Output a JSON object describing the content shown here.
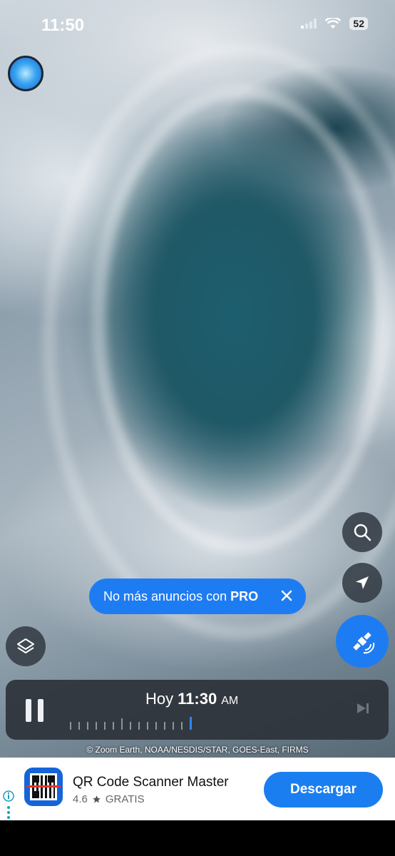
{
  "status_bar": {
    "time": "11:50",
    "battery": "52"
  },
  "promo": {
    "text_before": "No más anuncios con ",
    "text_strong": "PRO"
  },
  "timeline": {
    "day": "Hoy",
    "time": "11:30",
    "ampm": "AM"
  },
  "attribution": "© Zoom Earth, NOAA/NESDIS/STAR, GOES-East, FIRMS",
  "ad": {
    "title": "QR Code Scanner Master",
    "rating": "4.6",
    "price": "GRATIS",
    "cta": "Descargar"
  },
  "colors": {
    "accent": "#1e7cf2",
    "ocean": "#1f5866",
    "button_bg": "#343c44"
  },
  "icons": [
    "wifi-icon",
    "signal-icon",
    "search-icon",
    "location-arrow-icon",
    "satellite-icon",
    "layers-icon",
    "pause-icon",
    "skip-forward-icon",
    "close-icon",
    "star-icon",
    "info-icon"
  ]
}
